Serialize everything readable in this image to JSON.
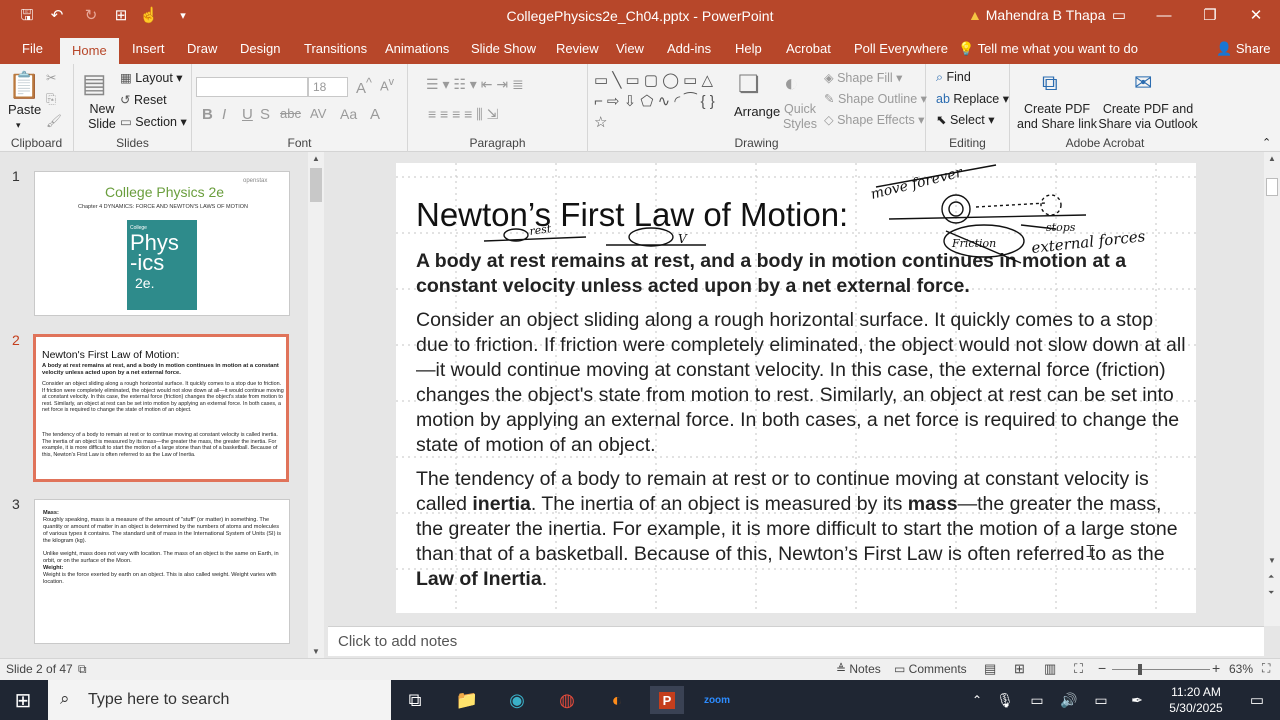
{
  "window": {
    "doc_title": "CollegePhysics2e_Ch04.pptx  -  PowerPoint",
    "user": "Mahendra B Thapa"
  },
  "tabs": [
    "File",
    "Home",
    "Insert",
    "Draw",
    "Design",
    "Transitions",
    "Animations",
    "Slide Show",
    "Review",
    "View",
    "Add-ins",
    "Help",
    "Acrobat",
    "Poll Everywhere"
  ],
  "tell_me": "Tell me what you want to do",
  "share": "Share",
  "ribbon": {
    "clipboard": {
      "label": "Clipboard",
      "paste": "Paste"
    },
    "slides": {
      "label": "Slides",
      "new_slide": "New Slide",
      "layout": "Layout",
      "reset": "Reset",
      "section": "Section"
    },
    "font": {
      "label": "Font",
      "size": "18"
    },
    "paragraph": {
      "label": "Paragraph"
    },
    "drawing": {
      "label": "Drawing",
      "arrange": "Arrange",
      "quick_styles": "Quick Styles",
      "shape_fill": "Shape Fill",
      "shape_outline": "Shape Outline",
      "shape_effects": "Shape Effects"
    },
    "editing": {
      "label": "Editing",
      "find": "Find",
      "replace": "Replace",
      "select": "Select"
    },
    "acrobat": {
      "label": "Adobe Acrobat",
      "create_pdf": "Create PDF and Share link",
      "create_outlook": "Create PDF and Share via Outlook"
    }
  },
  "thumbnails": [
    {
      "num": "1",
      "title": "College Physics 2e",
      "logo": "openstax",
      "subtitle": "Chapter 4 DYNAMICS: FORCE AND NEWTON'S LAWS OF MOTION",
      "cover_small": "College",
      "cover_big": "Phys-ics",
      "cover_ed": "2e."
    },
    {
      "num": "2",
      "title": "Newton's First Law of Motion:",
      "bold": "A body at rest remains at rest, and a body in motion continues in motion at a constant velocity unless acted upon by a net external force.",
      "p1": "Consider an object sliding along a rough horizontal surface. It quickly comes to a stop due to friction. If friction were completely eliminated, the object would not slow down at all—it would continue moving at constant velocity. In this case, the external force (friction) changes the object's state from motion to rest. Similarly, an object at rest can be set into motion by applying an external force. In both cases, a net force is required to change the state of motion of an object.",
      "p2": "The tendency of a body to remain at rest or to continue moving at constant velocity is called inertia. The inertia of an object is measured by its mass—the greater the mass, the greater the inertia. For example, it is more difficult to start the motion of a large stone than that of a basketball. Because of this, Newton's First Law is often referred to as the Law of Inertia."
    },
    {
      "num": "3",
      "h1": "Mass:",
      "t1": "Roughly speaking, mass is a measure of the amount of \"stuff\" (or matter) in something. The quantity or amount of matter in an object is determined by the numbers of atoms and molecules of various types it contains. The standard unit of mass in the International System of Units (SI) is the kilogram (kg).",
      "t2": "Unlike weight, mass does not vary with location. The mass of an object is the same on Earth, in orbit, or on the surface of the Moon.",
      "h2": "Weight:",
      "t3": "Weight is the force exerted by earth on an object. This is also called weight. Weight varies with location."
    }
  ],
  "slide": {
    "title": "Newton’s First Law of Motion:",
    "law": "A body at rest remains at rest, and a body in motion continues in motion at a constant velocity unless acted upon by a net external force.",
    "p1": "Consider an object sliding along a rough horizontal surface. It quickly comes to a stop due to friction. If friction were completely eliminated, the object would not slow down at all—it would continue moving at constant velocity. In this case, the external force (friction) changes the object's state from motion to rest. Similarly, an object at rest can be set into motion by applying an external force. In both cases, a net force is required to change the state of motion of an object.",
    "p2a": " The tendency of a body to remain at rest or to continue moving at constant velocity is called ",
    "p2_inertia": "inertia",
    "p2b": ". The inertia of an object is measured by its ",
    "p2_mass": "mass",
    "p2c": "—the greater the mass, the greater the inertia. For example, it is more difficult to start the motion of a large stone than that of a basketball. Because of this, Newton’s First Law is often referred to as the ",
    "p2_law": "Law of Inertia",
    "p2d": ".",
    "ink": {
      "move_forever": "move forever",
      "rest": "rest",
      "v": "V",
      "stops": "stops",
      "external_forces": "external forces",
      "friction": "Friction"
    }
  },
  "notes_placeholder": "Click to add notes",
  "status": {
    "slide_count": "Slide 2 of 47",
    "notes": "Notes",
    "comments": "Comments",
    "zoom": "63%"
  },
  "taskbar": {
    "search": "Type here to search",
    "time": "11:20 AM",
    "date": "5/30/2025"
  }
}
